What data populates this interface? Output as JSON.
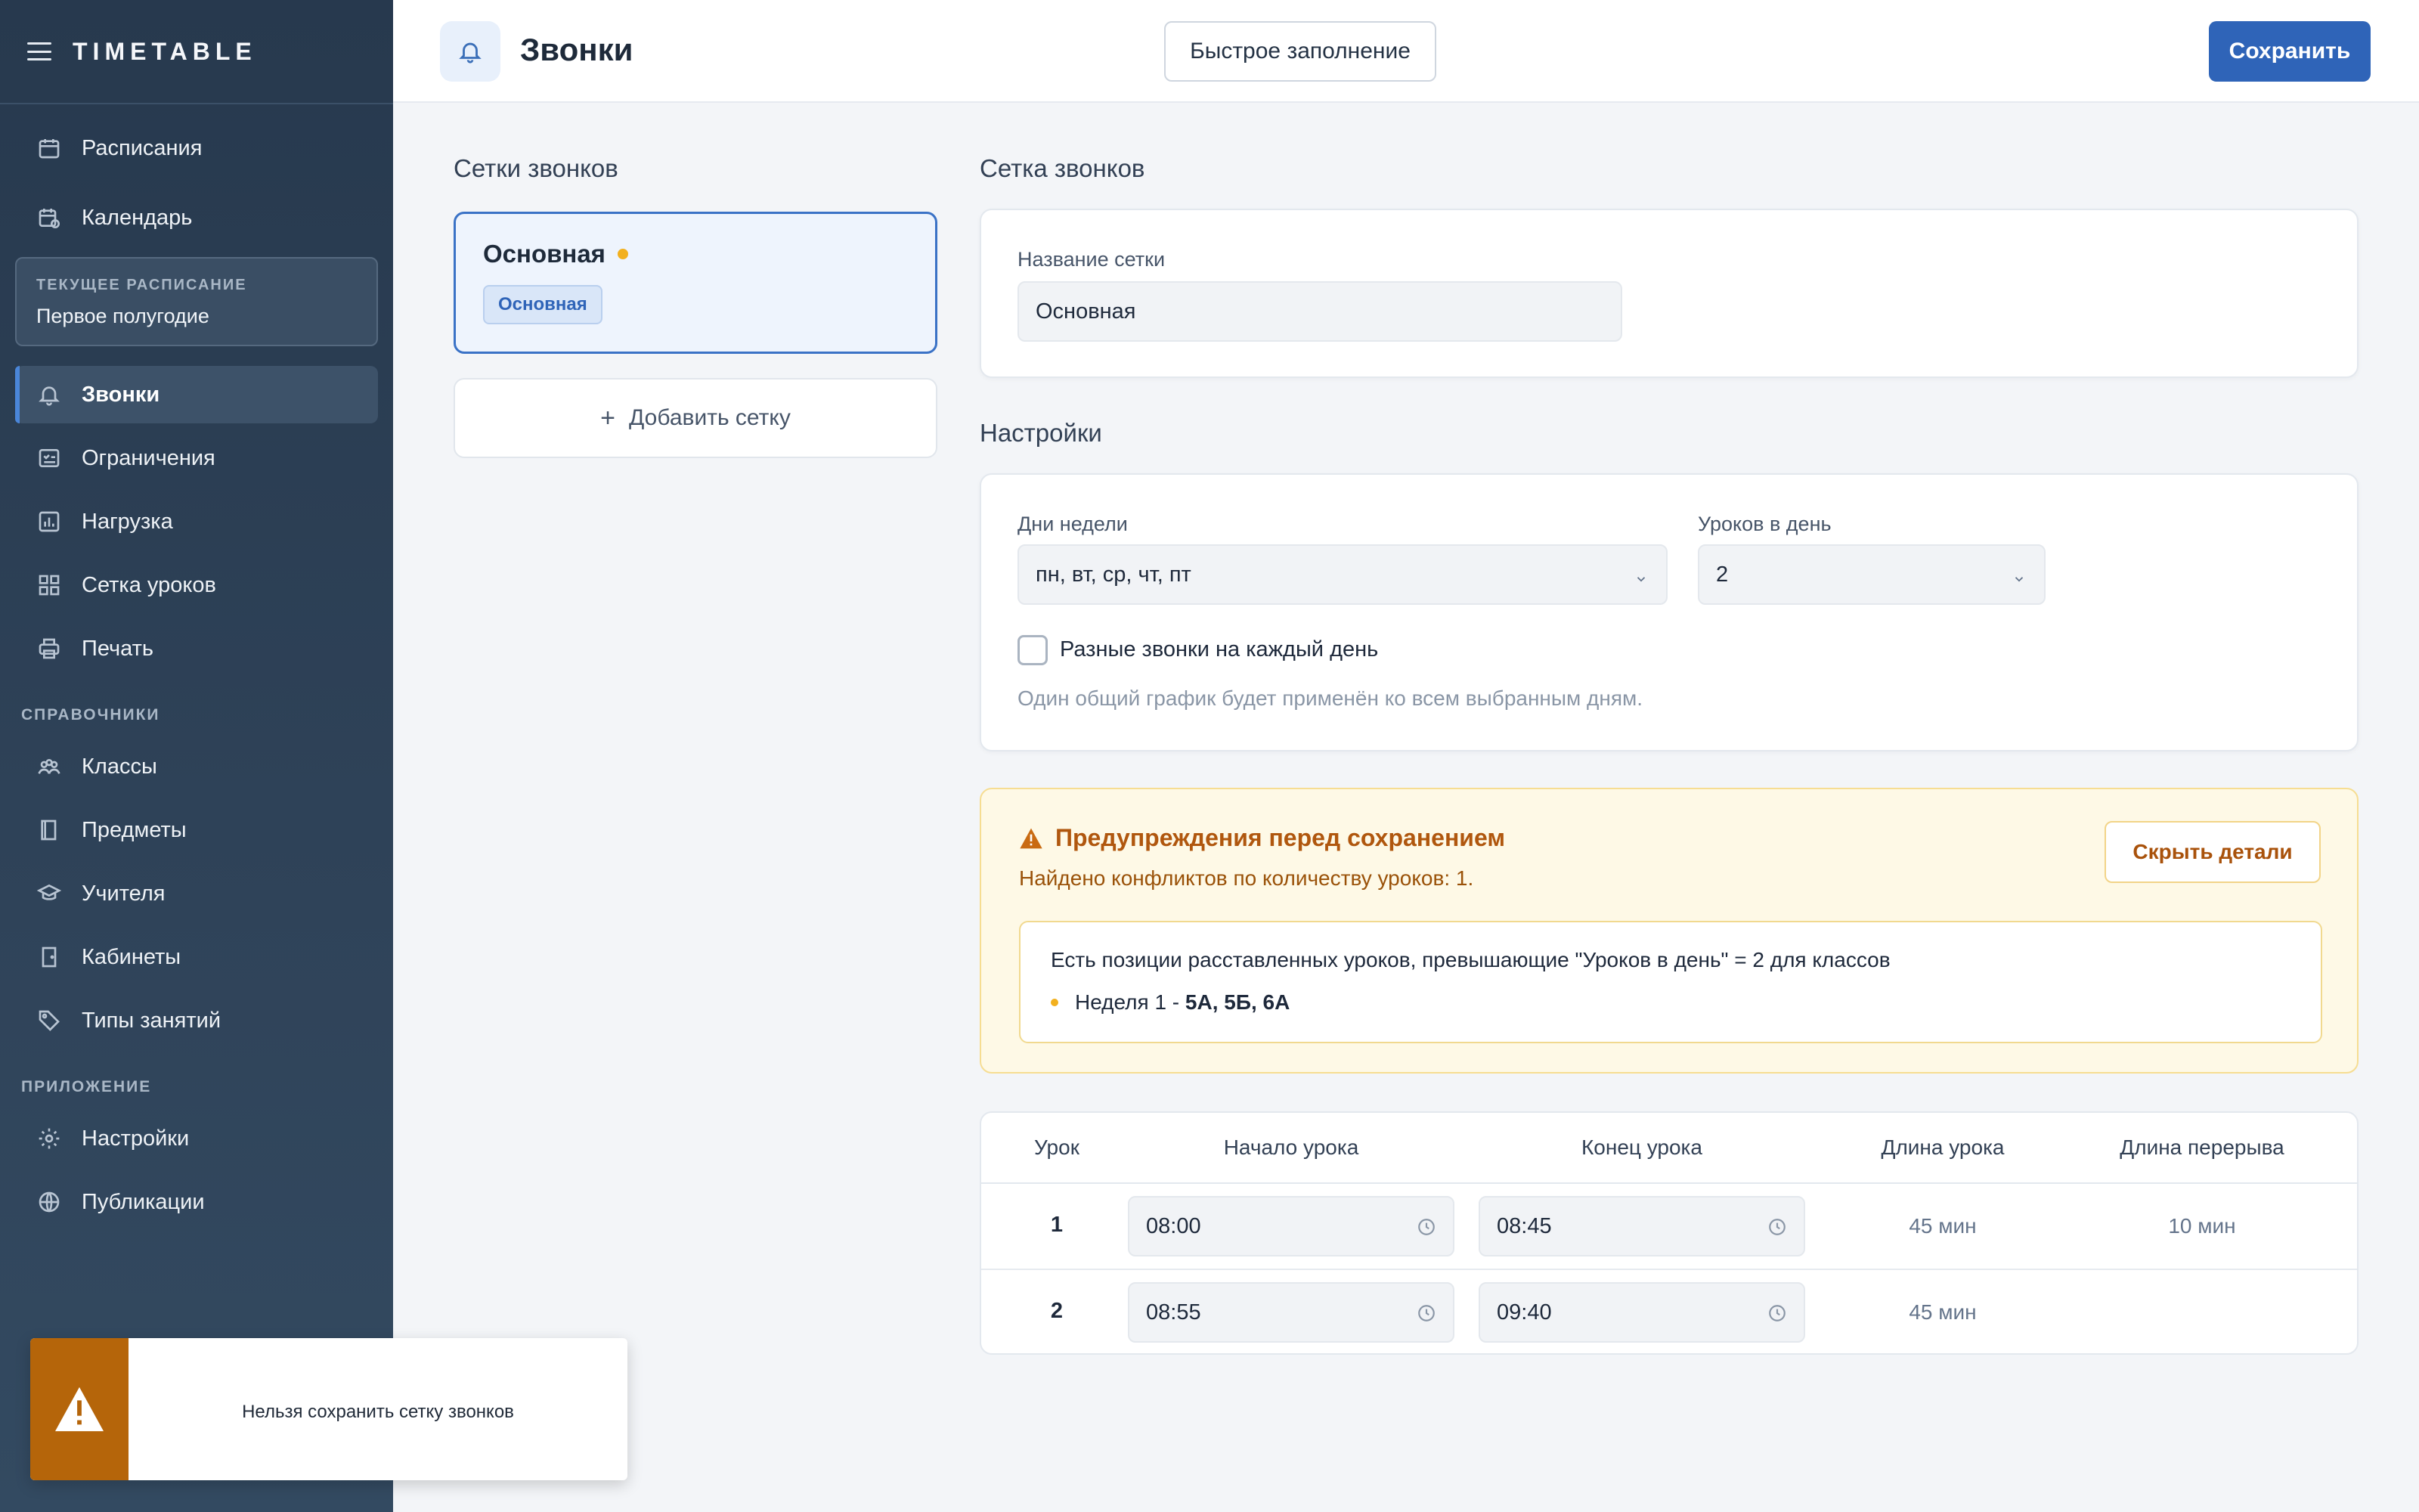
{
  "app": {
    "title": "TIMETABLE"
  },
  "sidebar": {
    "items_top": [
      {
        "label": "Расписания",
        "icon": "calendar-icon"
      },
      {
        "label": "Календарь",
        "icon": "calendar-clock-icon"
      }
    ],
    "current_schedule": {
      "label": "ТЕКУЩЕЕ РАСПИСАНИЕ",
      "value": "Первое полугодие"
    },
    "items_schedule": [
      {
        "label": "Звонки",
        "icon": "bell-icon",
        "active": true
      },
      {
        "label": "Ограничения",
        "icon": "checklist-icon"
      },
      {
        "label": "Нагрузка",
        "icon": "bar-chart-icon"
      },
      {
        "label": "Сетка уроков",
        "icon": "grid-icon"
      },
      {
        "label": "Печать",
        "icon": "printer-icon"
      }
    ],
    "section_refs": "СПРАВОЧНИКИ",
    "items_refs": [
      {
        "label": "Классы",
        "icon": "people-icon"
      },
      {
        "label": "Предметы",
        "icon": "book-icon"
      },
      {
        "label": "Учителя",
        "icon": "graduation-cap-icon"
      },
      {
        "label": "Кабинеты",
        "icon": "door-icon"
      },
      {
        "label": "Типы занятий",
        "icon": "tag-icon"
      }
    ],
    "section_app": "ПРИЛОЖЕНИЕ",
    "items_app": [
      {
        "label": "Настройки",
        "icon": "gear-icon"
      },
      {
        "label": "Публикации",
        "icon": "globe-icon"
      }
    ]
  },
  "header": {
    "title": "Звонки",
    "quick_fill_label": "Быстрое заполнение",
    "save_label": "Сохранить"
  },
  "grids": {
    "title": "Сетки звонков",
    "items": [
      {
        "name": "Основная",
        "badge": "Основная",
        "selected": true,
        "unsaved": true
      }
    ],
    "add_label": "Добавить сетку"
  },
  "grid_form": {
    "section_title": "Сетка звонков",
    "name_label": "Название сетки",
    "name_value": "Основная"
  },
  "settings": {
    "section_title": "Настройки",
    "days_label": "Дни недели",
    "days_value": "пн, вт, ср, чт, пт",
    "lessons_label": "Уроков в день",
    "lessons_value": "2",
    "different_bells_label": "Разные звонки на каждый день",
    "different_bells_checked": false,
    "hint": "Один общий график будет применён ко всем выбранным дням."
  },
  "warning": {
    "title": "Предупреждения перед сохранением",
    "subtitle": "Найдено конфликтов по количеству уроков: 1.",
    "hide_label": "Скрыть детали",
    "detail_text": "Есть позиции расставленных уроков, превышающие \"Уроков в день\" = 2 для классов",
    "week_label": "Неделя 1 - ",
    "week_classes": "5А, 5Б, 6А",
    "accent": "#b0570e"
  },
  "bells_table": {
    "headers": [
      "Урок",
      "Начало урока",
      "Конец урока",
      "Длина урока",
      "Длина перерыва"
    ],
    "rows": [
      {
        "num": "1",
        "start": "08:00",
        "end": "08:45",
        "length": "45 мин",
        "break": "10 мин"
      },
      {
        "num": "2",
        "start": "08:55",
        "end": "09:40",
        "length": "45 мин",
        "break": ""
      }
    ]
  },
  "toast": {
    "message": "Нельзя сохранить сетку звонков",
    "color": "#b5650a"
  },
  "colors": {
    "primary": "#2f64b8",
    "sidebar": "#2f4359",
    "accent_dot": "#f2b01e"
  }
}
